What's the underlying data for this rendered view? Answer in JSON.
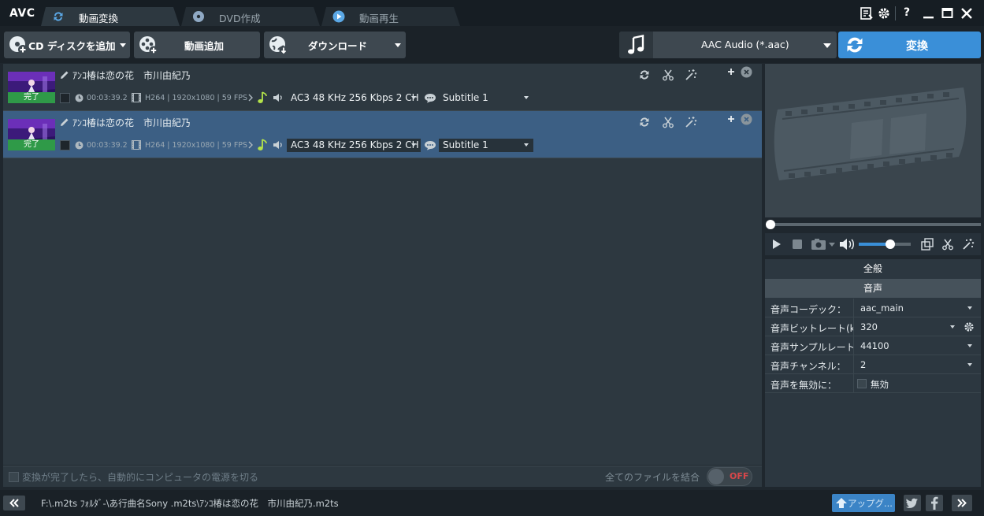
{
  "app": {
    "logo": "AVC"
  },
  "tabs": [
    {
      "label": "動画変換",
      "active": true,
      "icon": "refresh-icon"
    },
    {
      "label": "DVD作成",
      "active": false,
      "icon": "disc-icon"
    },
    {
      "label": "動画再生",
      "active": false,
      "icon": "play-icon"
    }
  ],
  "window_controls": {
    "help_label": "?"
  },
  "toolbar": {
    "add_cd_label": "CD ディスクを追加",
    "add_video_label": "動画追加",
    "download_label": "ダウンロード",
    "output_format": "AAC Audio (*.aac)",
    "convert_label": "変換"
  },
  "files": [
    {
      "title": "ｱﾝｺ椿は恋の花　市川由紀乃",
      "status": "完了",
      "duration": "00:03:39.2",
      "video_info": "H264 | 1920x1080 | 59 FPS",
      "audio_track": "AC3 48 KHz 256 Kbps 2 CH",
      "subtitle": "Subtitle 1",
      "selected": false
    },
    {
      "title": "ｱﾝｺ椿は恋の花　市川由紀乃",
      "status": "完了",
      "duration": "00:03:39.2",
      "video_info": "H264 | 1920x1080 | 59 FPS",
      "audio_track": "AC3 48 KHz 256 Kbps 2 CH",
      "subtitle": "Subtitle 1",
      "selected": true
    }
  ],
  "list_footer": {
    "shutdown_label": "変換が完了したら、自動的にコンピュータの電源を切る",
    "merge_label": "全てのファイルを結合",
    "merge_toggle": "OFF"
  },
  "player": {
    "volume_level": 0.6,
    "seek_position": 0
  },
  "properties": {
    "tab_general": "全般",
    "tab_audio": "音声",
    "rows": [
      {
        "key": "音声コーデック：",
        "value": "aac_main",
        "dropdown": true
      },
      {
        "key": "音声ビットレート(k",
        "value": "320",
        "dropdown": true,
        "gear": true
      },
      {
        "key": "音声サンプルレート",
        "value": "44100",
        "dropdown": true
      },
      {
        "key": "音声チャンネル：",
        "value": "2",
        "dropdown": true
      },
      {
        "key": "音声を無効に：",
        "value": "無効",
        "checkbox": true
      }
    ]
  },
  "status": {
    "path": "F:\\.m2ts ﾌｫﾙﾀﾞ-\\あ行曲名Sony .m2ts\\ｱﾝｺ椿は恋の花　市川由紀乃.m2ts",
    "upgrade_label": "アップグ..."
  },
  "colors": {
    "accent": "#3a8fd8",
    "done_badge": "#2f9a48",
    "selected_row": "#3c5f84",
    "toggle_off": "#d8474a"
  }
}
